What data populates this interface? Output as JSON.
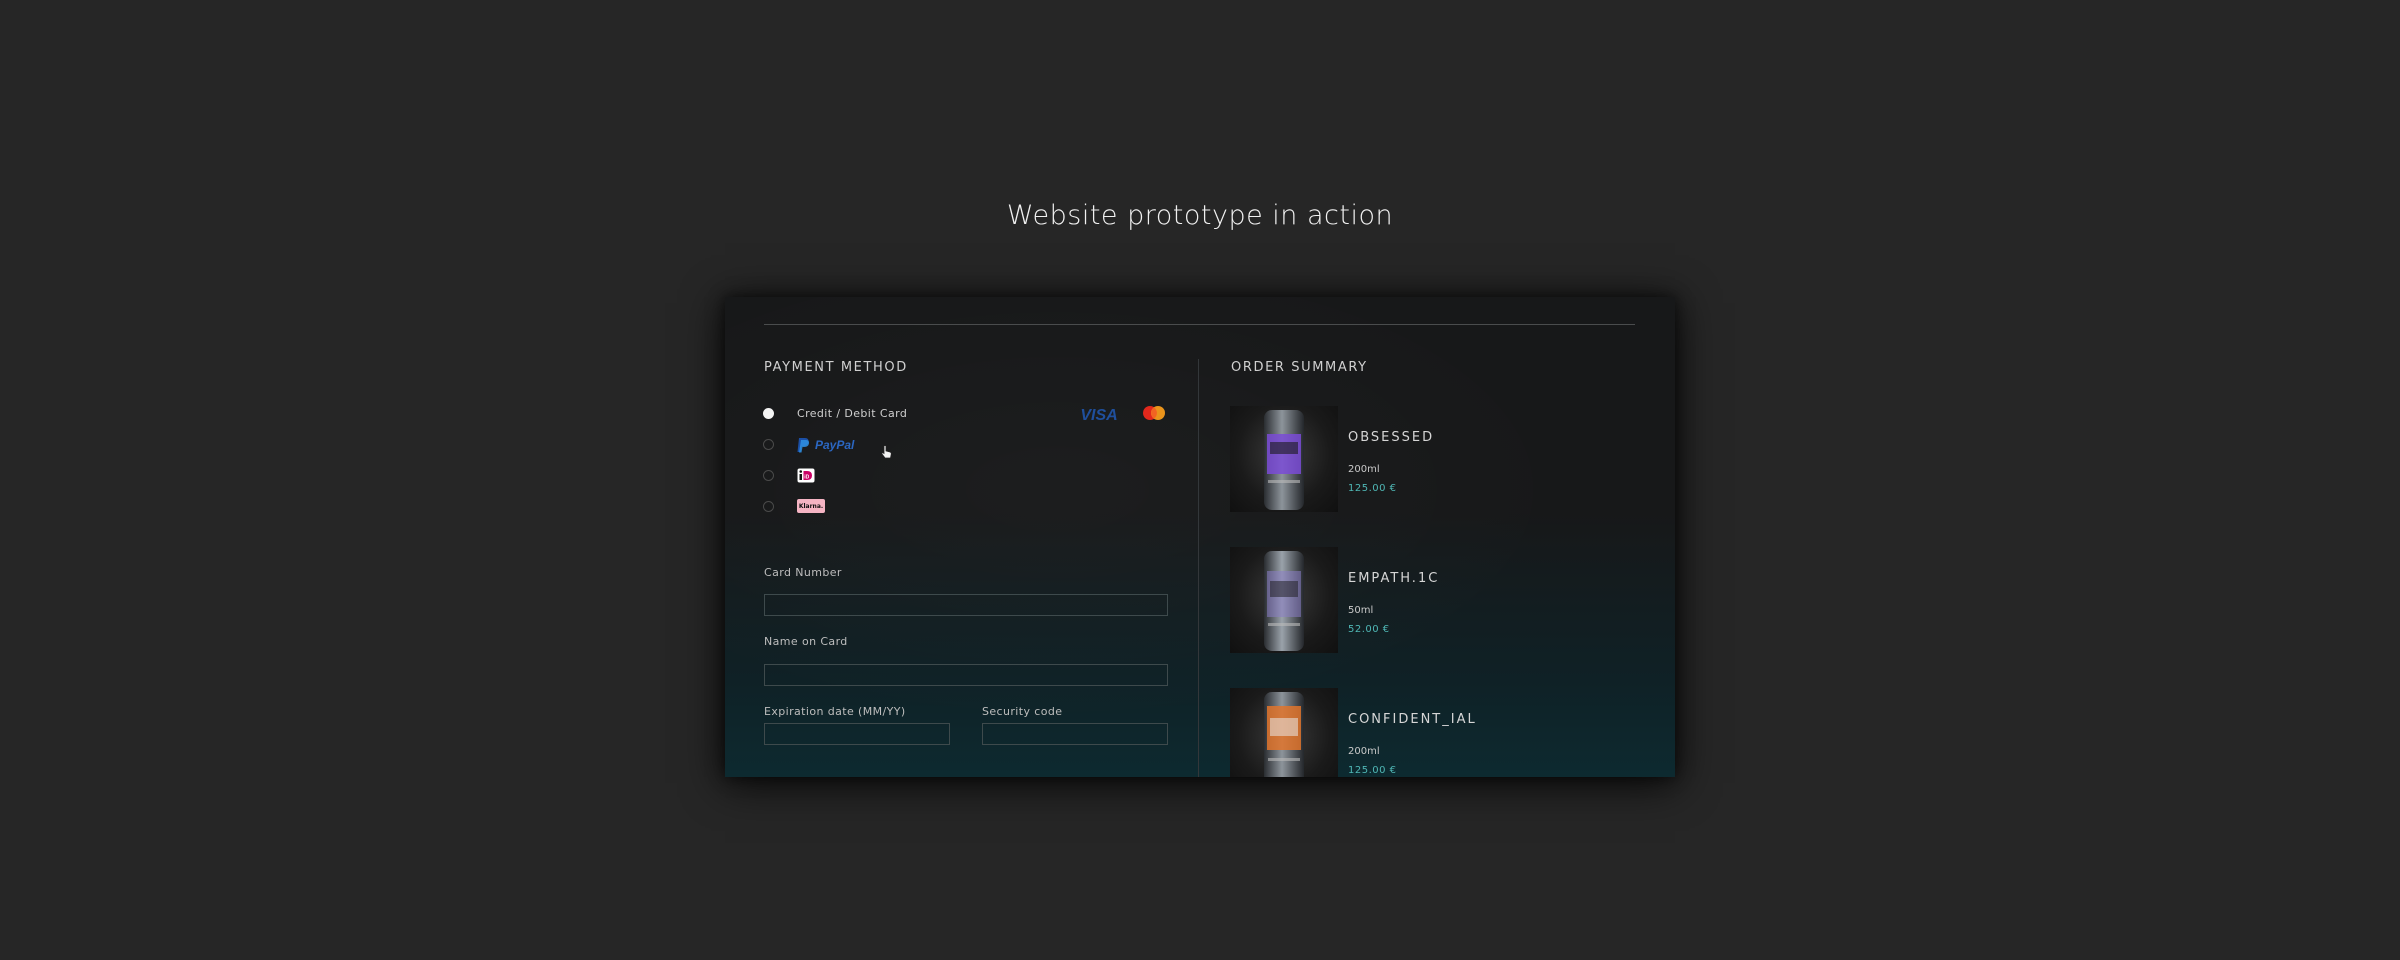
{
  "headline": "Website prototype in action",
  "payment": {
    "title": "PAYMENT METHOD",
    "options": [
      {
        "label": "Credit / Debit Card",
        "selected": true
      },
      {
        "label": "PayPal",
        "selected": false
      },
      {
        "label": "iD",
        "selected": false
      },
      {
        "label": "Klarna.",
        "selected": false
      }
    ],
    "card_brands": [
      "VISA",
      "mastercard-icon"
    ],
    "fields": {
      "card_number": {
        "label": "Card Number",
        "value": ""
      },
      "name_on_card": {
        "label": "Name on Card",
        "value": ""
      },
      "expiration": {
        "label": "Expiration date (MM/YY)",
        "value": ""
      },
      "security_code": {
        "label": "Security code",
        "value": ""
      }
    }
  },
  "order": {
    "title": "ORDER SUMMARY",
    "items": [
      {
        "name": "OBSESSED",
        "size": "200ml",
        "price": "125.00 €",
        "accent": "#7a4bd6"
      },
      {
        "name": "EMPATH.1C",
        "size": "50ml",
        "price": "52.00 €",
        "accent": "#8a7dc6"
      },
      {
        "name": "CONFIDENT_IAL",
        "size": "200ml",
        "price": "125.00 €",
        "accent": "#e0742c"
      }
    ]
  },
  "colors": {
    "price": "#4fb7b5",
    "background": "#262626",
    "panel": "#171819"
  }
}
